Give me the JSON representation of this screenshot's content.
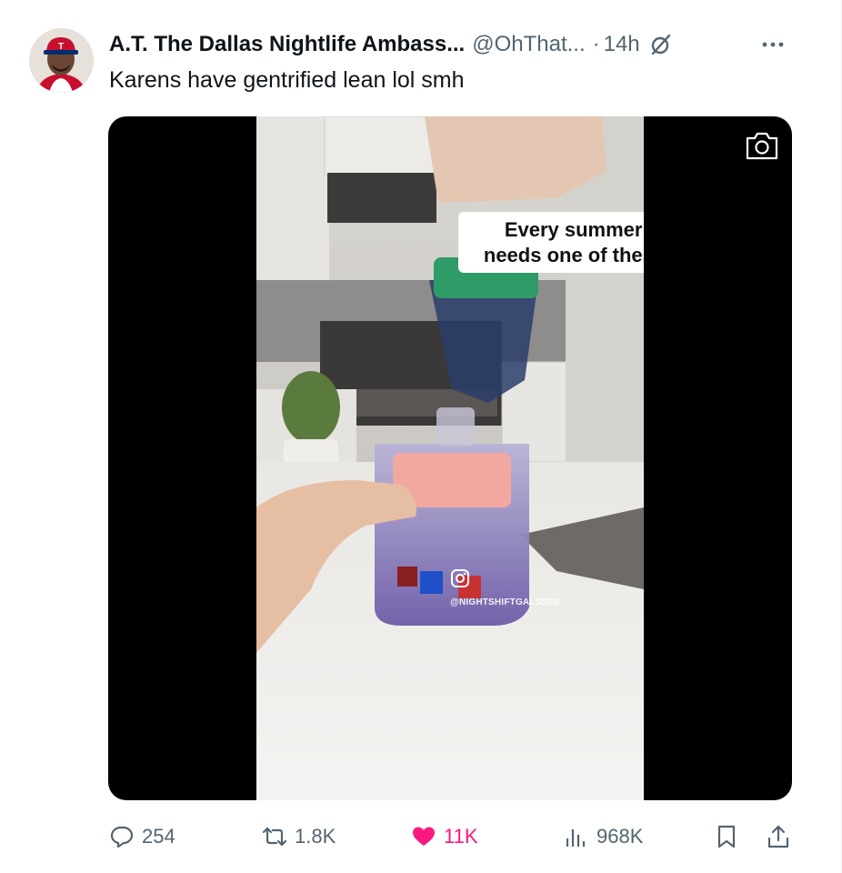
{
  "author": {
    "name": "A.T. The Dallas Nightlife Ambass...",
    "handle": "@OhThat...",
    "separator": "·",
    "time": "14h"
  },
  "tweet": {
    "text": "Karens have gentrified lean lol smh"
  },
  "media": {
    "caption_line1": "Every summer mom",
    "caption_line2": "needs one of these 😳🏝",
    "watermark": "@NIGHTSHIFTGALSSES"
  },
  "actions": {
    "replies": "254",
    "reposts": "1.8K",
    "likes": "11K",
    "views": "968K"
  },
  "colors": {
    "text_primary": "#0f1419",
    "text_secondary": "#536471",
    "like_pink": "#f91880"
  },
  "icons": {
    "grok": "grok-icon",
    "more": "more-icon",
    "camera": "camera-icon",
    "reply": "reply-icon",
    "repost": "repost-icon",
    "like": "heart-icon",
    "views": "views-icon",
    "bookmark": "bookmark-icon",
    "share": "share-icon"
  }
}
